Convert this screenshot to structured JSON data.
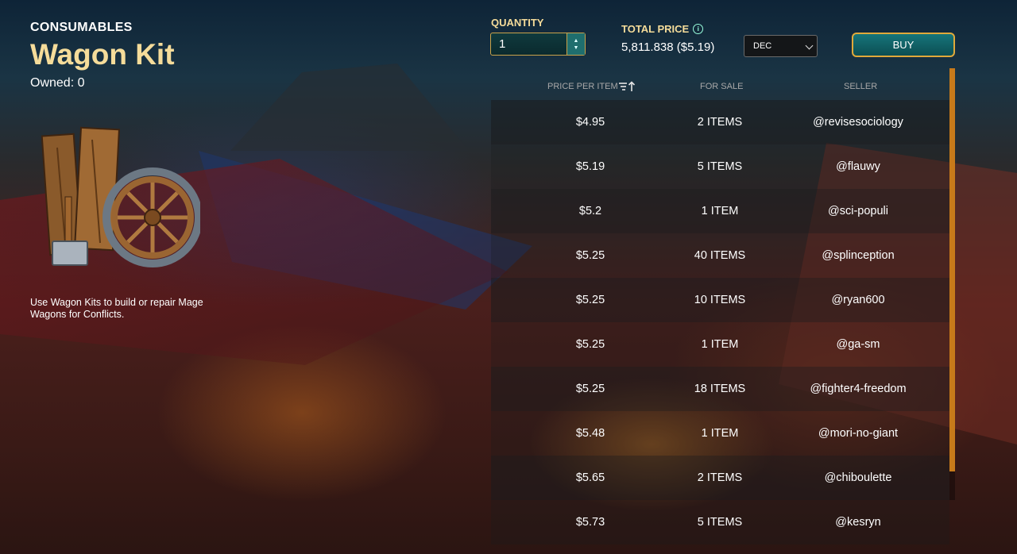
{
  "item": {
    "category": "CONSUMABLES",
    "name": "Wagon Kit",
    "owned": "Owned: 0",
    "description": "Use Wagon Kits to build or repair Mage Wagons for Conflicts.",
    "image_icon": "wagon-kit-icon"
  },
  "purchase": {
    "quantity_label": "QUANTITY",
    "quantity_value": "1",
    "total_price_label": "TOTAL PRICE",
    "total_price_value": "5,811.838 ($5.19)",
    "currency": "DEC",
    "buy_label": "BUY"
  },
  "listing": {
    "headers": {
      "price": "PRICE PER ITEM",
      "for_sale": "FOR SALE",
      "seller": "SELLER"
    },
    "rows": [
      {
        "price": "$4.95",
        "for_sale": "2 ITEMS",
        "seller": "@revisesociology"
      },
      {
        "price": "$5.19",
        "for_sale": "5 ITEMS",
        "seller": "@flauwy"
      },
      {
        "price": "$5.2",
        "for_sale": "1 ITEM",
        "seller": "@sci-populi"
      },
      {
        "price": "$5.25",
        "for_sale": "40 ITEMS",
        "seller": "@splinception"
      },
      {
        "price": "$5.25",
        "for_sale": "10 ITEMS",
        "seller": "@ryan600"
      },
      {
        "price": "$5.25",
        "for_sale": "1 ITEM",
        "seller": "@ga-sm"
      },
      {
        "price": "$5.25",
        "for_sale": "18 ITEMS",
        "seller": "@fighter4-freedom"
      },
      {
        "price": "$5.48",
        "for_sale": "1 ITEM",
        "seller": "@mori-no-giant"
      },
      {
        "price": "$5.65",
        "for_sale": "2 ITEMS",
        "seller": "@chiboulette"
      },
      {
        "price": "$5.73",
        "for_sale": "5 ITEMS",
        "seller": "@kesryn"
      }
    ]
  },
  "colors": {
    "title_gold": "#f5dc9a",
    "button_teal": "#16757a",
    "button_border": "#e0a93a",
    "scroll_orange": "#c77a1a"
  }
}
